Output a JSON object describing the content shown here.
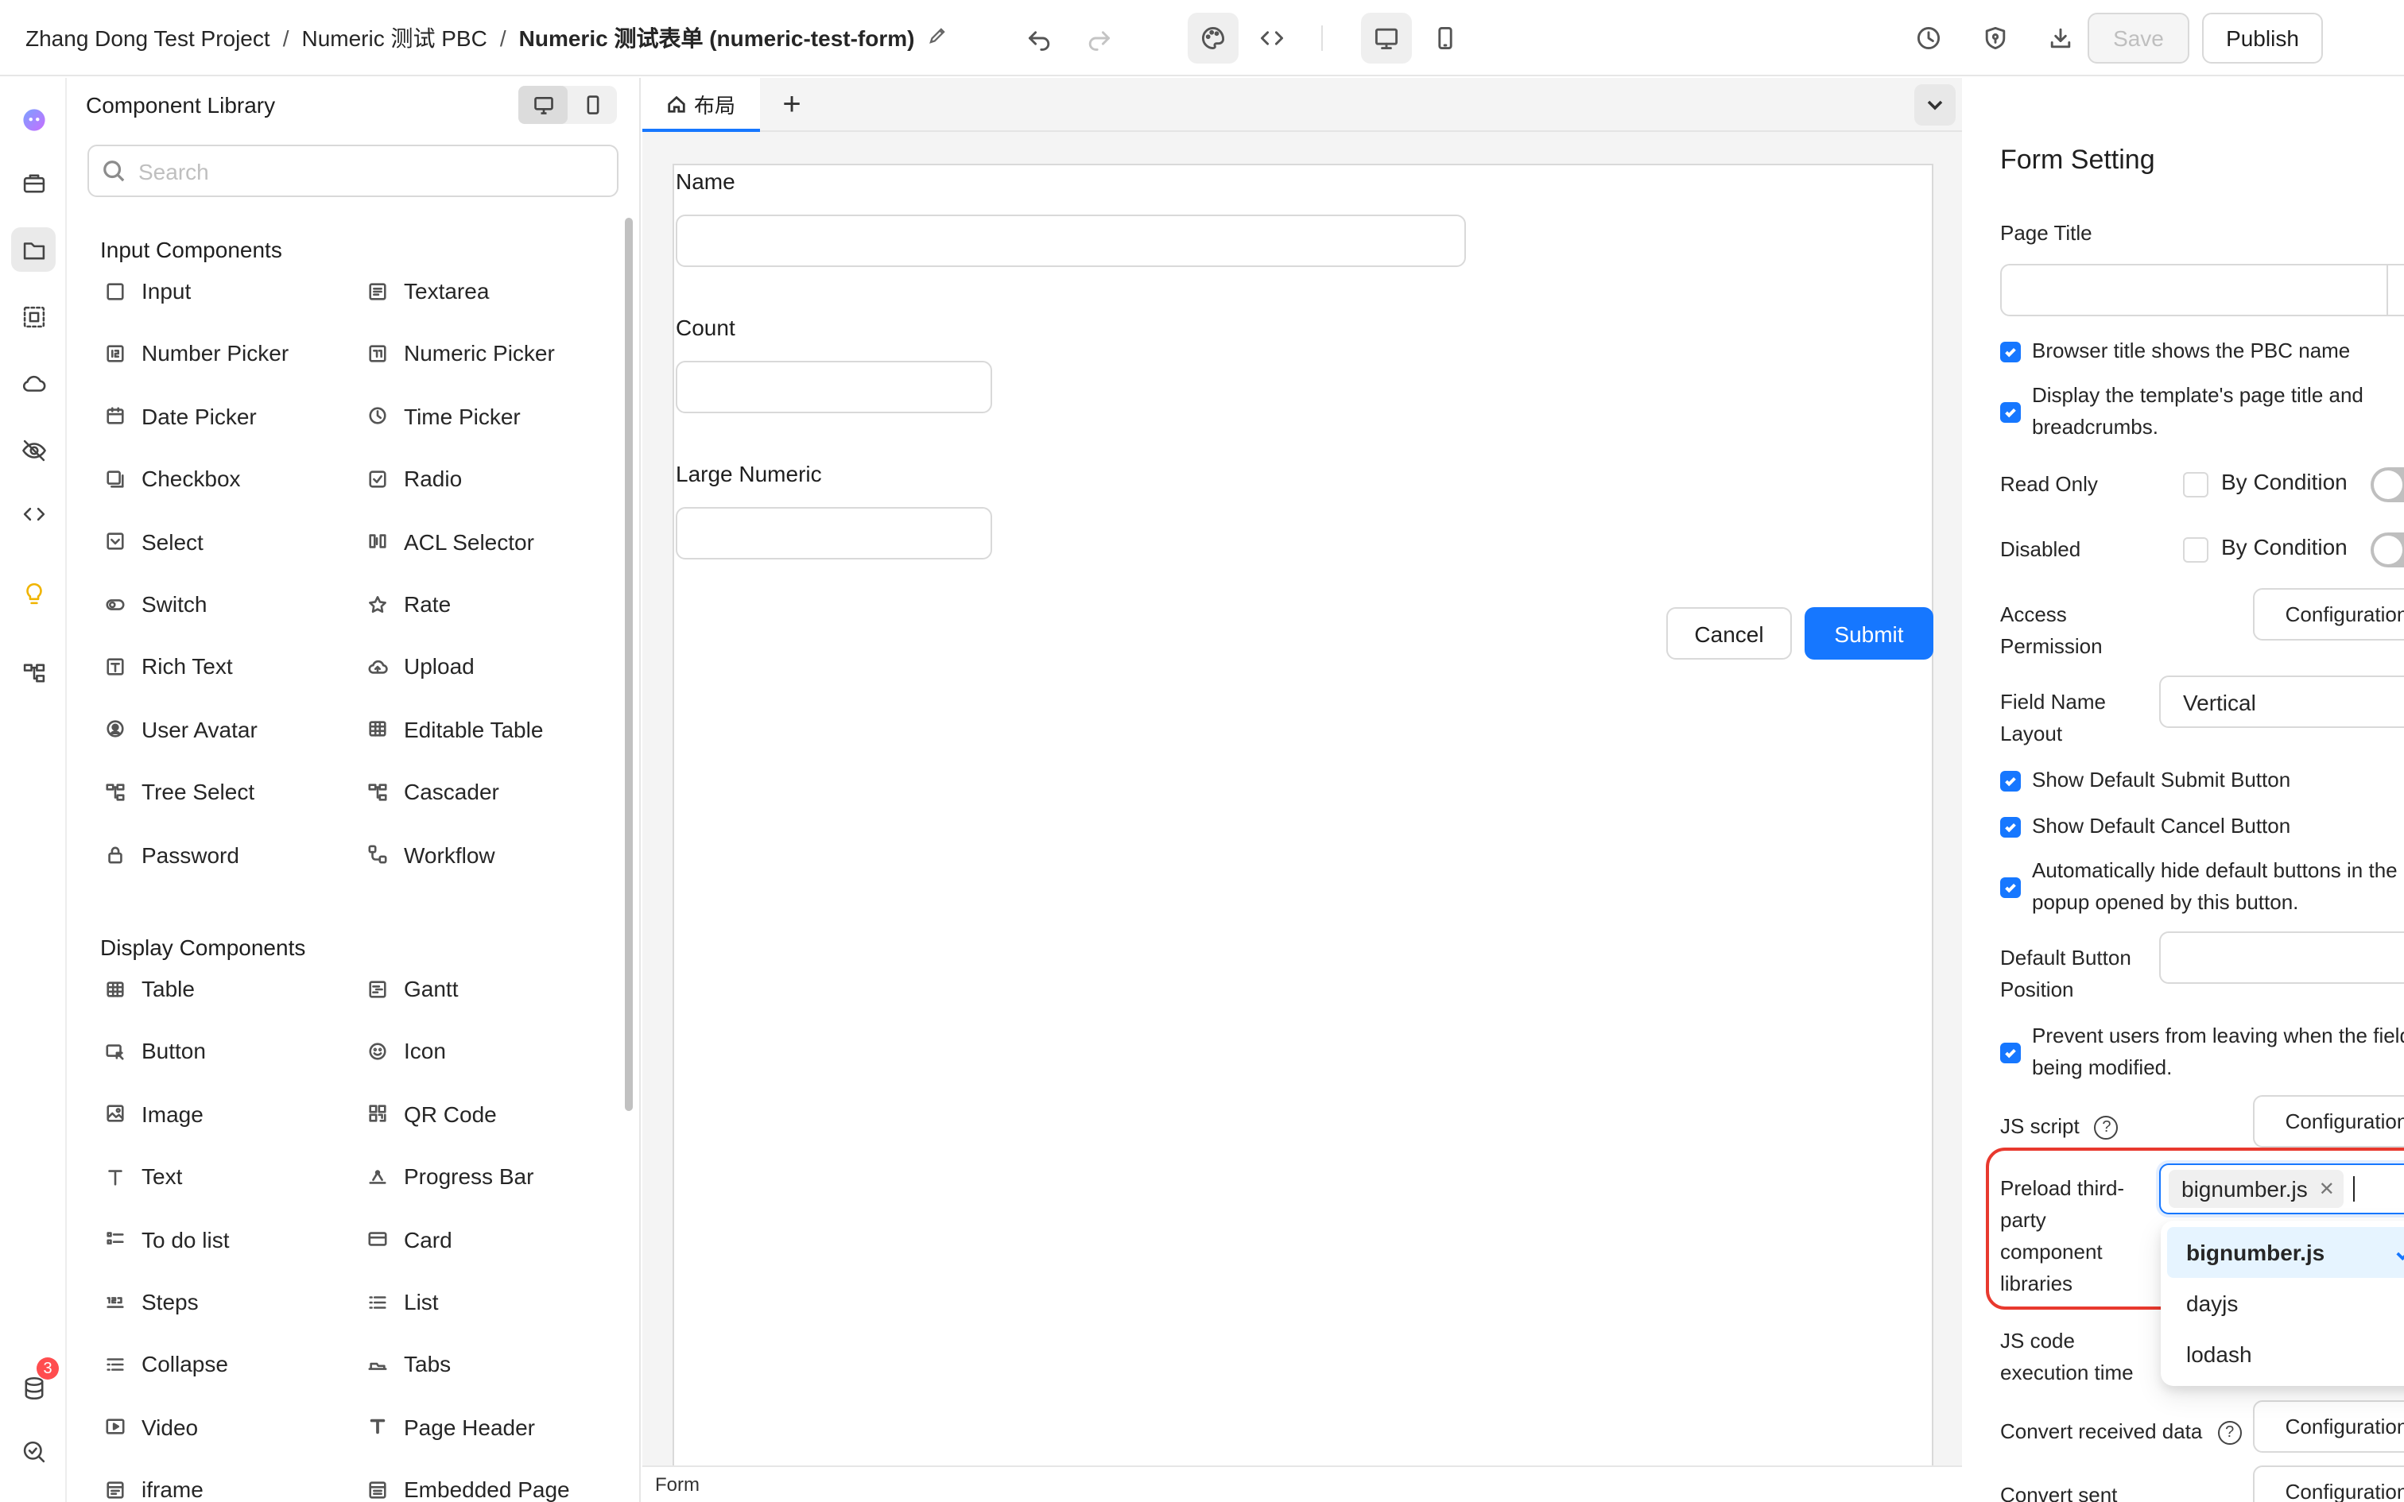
{
  "header": {
    "breadcrumb": [
      "Zhang Dong Test Project",
      "Numeric 测试 PBC",
      "Numeric 测试表单 (numeric-test-form)"
    ],
    "separator": "/",
    "save_label": "Save",
    "publish_label": "Publish",
    "close_glyph": "✕"
  },
  "library": {
    "title": "Component Library",
    "search_placeholder": "Search",
    "sections": [
      {
        "title": "Input Components",
        "items": [
          {
            "label": "Input",
            "icon": "input-icon"
          },
          {
            "label": "Textarea",
            "icon": "textarea-icon"
          },
          {
            "label": "Number Picker",
            "icon": "number-icon"
          },
          {
            "label": "Numeric Picker",
            "icon": "numeric-icon"
          },
          {
            "label": "Date Picker",
            "icon": "calendar-icon"
          },
          {
            "label": "Time Picker",
            "icon": "clock-icon"
          },
          {
            "label": "Checkbox",
            "icon": "checkbox-icon"
          },
          {
            "label": "Radio",
            "icon": "radio-icon"
          },
          {
            "label": "Select",
            "icon": "select-icon"
          },
          {
            "label": "ACL Selector",
            "icon": "acl-icon"
          },
          {
            "label": "Switch",
            "icon": "switch-icon"
          },
          {
            "label": "Rate",
            "icon": "star-icon"
          },
          {
            "label": "Rich Text",
            "icon": "richtext-icon"
          },
          {
            "label": "Upload",
            "icon": "upload-cloud-icon"
          },
          {
            "label": "User Avatar",
            "icon": "avatar-icon"
          },
          {
            "label": "Editable Table",
            "icon": "table-icon"
          },
          {
            "label": "Tree Select",
            "icon": "tree-icon"
          },
          {
            "label": "Cascader",
            "icon": "cascader-icon"
          },
          {
            "label": "Password",
            "icon": "lock-icon"
          },
          {
            "label": "Workflow",
            "icon": "workflow-icon"
          }
        ]
      },
      {
        "title": "Display Components",
        "items": [
          {
            "label": "Table",
            "icon": "table-icon"
          },
          {
            "label": "Gantt",
            "icon": "gantt-icon"
          },
          {
            "label": "Button",
            "icon": "button-icon"
          },
          {
            "label": "Icon",
            "icon": "smile-icon"
          },
          {
            "label": "Image",
            "icon": "image-icon"
          },
          {
            "label": "QR Code",
            "icon": "qrcode-icon"
          },
          {
            "label": "Text",
            "icon": "text-icon"
          },
          {
            "label": "Progress Bar",
            "icon": "progress-icon"
          },
          {
            "label": "To do list",
            "icon": "todo-icon"
          },
          {
            "label": "Card",
            "icon": "card-icon"
          },
          {
            "label": "Steps",
            "icon": "steps-icon"
          },
          {
            "label": "List",
            "icon": "list-icon"
          },
          {
            "label": "Collapse",
            "icon": "collapse-icon"
          },
          {
            "label": "Tabs",
            "icon": "tabs-icon"
          },
          {
            "label": "Video",
            "icon": "video-icon"
          },
          {
            "label": "Page Header",
            "icon": "page-header-icon"
          },
          {
            "label": "iframe",
            "icon": "iframe-icon"
          },
          {
            "label": "Embedded Page",
            "icon": "embedded-icon"
          }
        ]
      }
    ]
  },
  "rail": {
    "notification_count": "3"
  },
  "canvas": {
    "tab_label": "布局",
    "add_glyph": "+",
    "fields": [
      {
        "label": "Name"
      },
      {
        "label": "Count"
      },
      {
        "label": "Large Numeric"
      }
    ],
    "cancel_label": "Cancel",
    "submit_label": "Submit",
    "footer_label": "Form"
  },
  "settings": {
    "title": "Form Setting",
    "page_title_label": "Page Title",
    "page_title_value": "",
    "browser_title_label": "Browser title shows the PBC name",
    "display_template_label": "Display the template's page title and breadcrumbs.",
    "read_only_label": "Read Only",
    "disabled_label": "Disabled",
    "by_condition_label": "By Condition",
    "access_permission_label": "Access Permission",
    "configuration_label": "Configuration",
    "field_name_layout_label": "Field Name Layout",
    "field_name_layout_value": "Vertical",
    "show_submit_label": "Show Default Submit Button",
    "show_cancel_label": "Show Default Cancel Button",
    "auto_hide_label": "Automatically hide default buttons in the popup opened by this button.",
    "default_button_position_label": "Default Button Position",
    "default_button_position_value": "",
    "prevent_leave_label": "Prevent users from leaving when the field is being modified.",
    "js_script_label": "JS script",
    "preload_label": "Preload third-party component libraries",
    "preload_selected": "bignumber.js",
    "preload_options": [
      "bignumber.js",
      "dayjs",
      "lodash"
    ],
    "js_exec_label": "JS code execution time",
    "convert_received_label": "Convert received data",
    "convert_sent_label": "Convert sent data",
    "help_glyph": "?"
  },
  "colors": {
    "primary": "#1677ff",
    "highlight": "#e8392e",
    "badge": "#ff4d4f"
  }
}
